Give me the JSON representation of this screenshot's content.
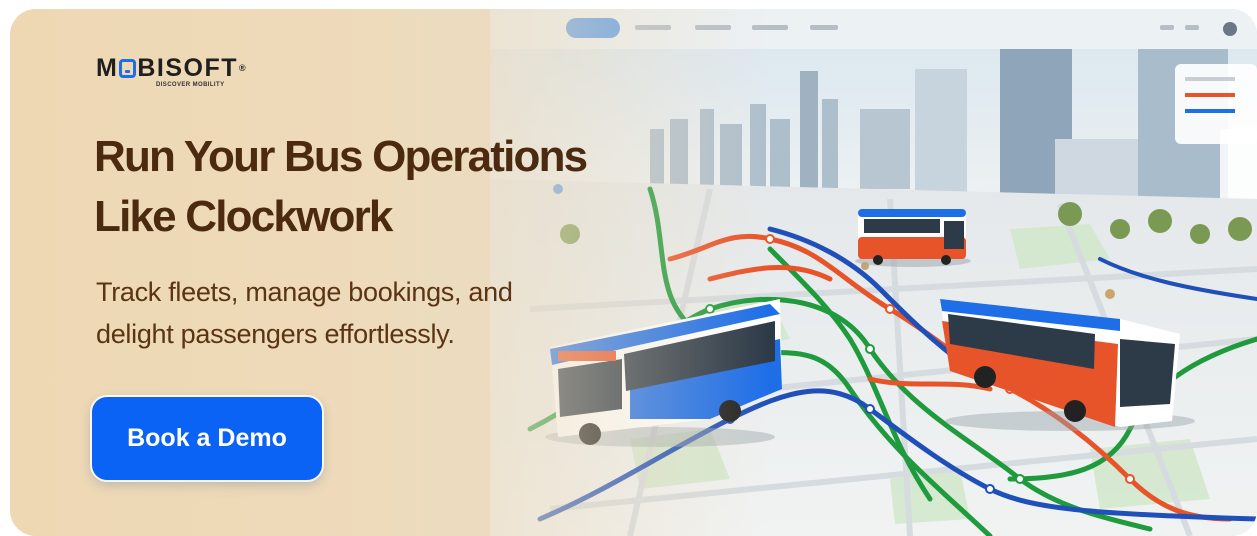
{
  "brand": {
    "name_prefix": "M",
    "name_suffix": "BISOFT",
    "registered_mark": "®",
    "tagline": "DISCOVER MOBILITY",
    "accent_color": "#0b63f6",
    "text_color": "#4b2a0f"
  },
  "hero": {
    "headline_line1": "Run Your Bus Operations",
    "headline_line2": "Like Clockwork",
    "subtext_line1": "Track fleets, manage bookings, and",
    "subtext_line2": "delight passengers effortlessly."
  },
  "cta": {
    "label": "Book a Demo"
  },
  "illustration": {
    "icons": [
      "bus-icon",
      "city-skyline",
      "route-map"
    ],
    "route_colors": [
      "#1f9a3c",
      "#e8542a",
      "#1f4fb8"
    ]
  }
}
